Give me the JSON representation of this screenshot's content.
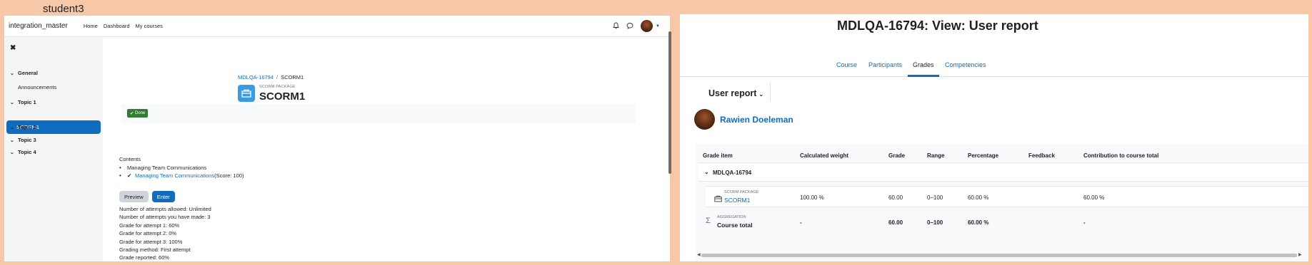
{
  "caption": "student3",
  "left": {
    "navbar": {
      "brand": "integration_master",
      "links": [
        "Home",
        "Dashboard",
        "My courses"
      ],
      "icons": [
        "bell-icon",
        "chat-icon",
        "avatar",
        "chevron-down-icon"
      ]
    },
    "drawer": {
      "close_icon": "✖",
      "sections": [
        {
          "label": "General",
          "items": [
            "Announcements"
          ]
        },
        {
          "label": "Topic 1",
          "items": [
            "SCORM1"
          ]
        },
        {
          "label": "Topic 2"
        },
        {
          "label": "Topic 3"
        },
        {
          "label": "Topic 4"
        }
      ],
      "active_item": "SCORM1"
    },
    "breadcrumb": [
      "MDLQA-16794",
      "SCORM1"
    ],
    "activity": {
      "type": "SCORM PACKAGE",
      "title": "SCORM1",
      "done_label": "Done"
    },
    "contents": {
      "label": "Contents",
      "items": [
        {
          "text": "Managing Team Communications"
        },
        {
          "link": "Managing Team Communications",
          "suffix": "(Score: 100)"
        }
      ]
    },
    "buttons": {
      "preview": "Preview",
      "enter": "Enter"
    },
    "attempts": [
      "Number of attempts allowed: Unlimited",
      "Number of attempts you have made: 3",
      "Grade for attempt 1: 60%",
      "Grade for attempt 2: 0%",
      "Grade for attempt 3: 100%",
      "Grading method: First attempt",
      "Grade reported: 60%"
    ]
  },
  "right": {
    "header": "MDLQA-16794: View: User report",
    "tabs": [
      "Course",
      "Participants",
      "Grades",
      "Competencies"
    ],
    "active_tab": "Grades",
    "report_selector": "User report",
    "user": "Rawien Doeleman",
    "table": {
      "headers": [
        "Grade item",
        "Calculated weight",
        "Grade",
        "Range",
        "Percentage",
        "Feedback",
        "Contribution to course total"
      ],
      "category": "MDLQA-16794",
      "item": {
        "type": "SCORM PACKAGE",
        "name": "SCORM1",
        "weight": "100.00 %",
        "grade": "60.00",
        "range": "0–100",
        "percentage": "60.00 %",
        "feedback": "",
        "contribution": "60.00 %"
      },
      "total": {
        "type": "AGGREGATION",
        "name": "Course total",
        "weight": "-",
        "grade": "60.00",
        "range": "0–100",
        "percentage": "60.00 %",
        "feedback": "",
        "contribution": "-"
      }
    }
  }
}
